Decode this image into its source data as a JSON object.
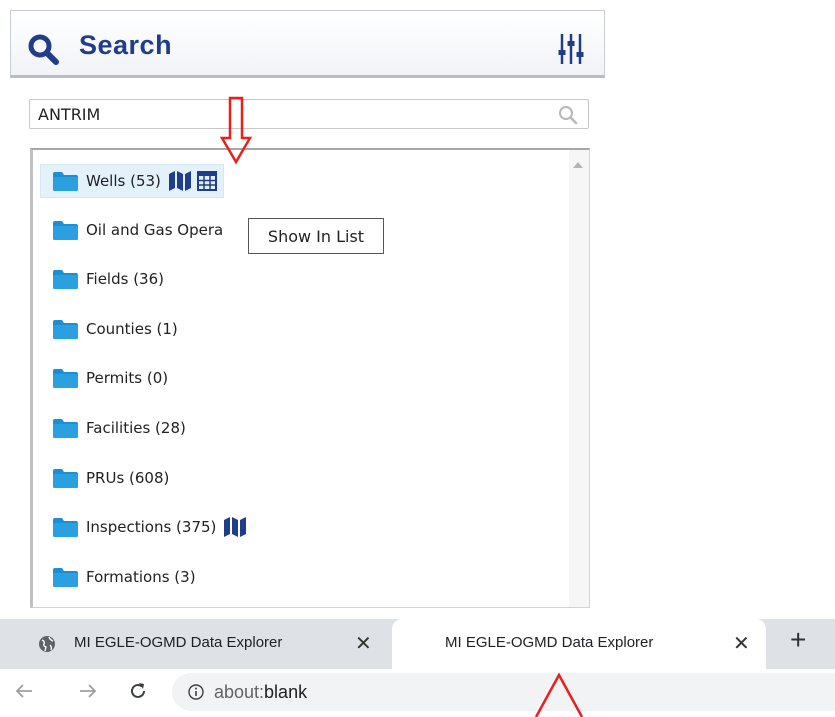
{
  "header": {
    "title": "Search",
    "icon": "search-icon",
    "settings_icon": "filter-sliders-icon"
  },
  "search": {
    "value": "ANTRIM"
  },
  "tree": {
    "items": [
      {
        "label": "Wells (53)",
        "has_map": true,
        "has_table": true,
        "selected": true
      },
      {
        "label": "Oil and Gas Opera",
        "has_map": false,
        "has_table": false
      },
      {
        "label": "Fields (36)",
        "has_map": false,
        "has_table": false
      },
      {
        "label": "Counties (1)",
        "has_map": false,
        "has_table": false
      },
      {
        "label": "Permits (0)",
        "has_map": false,
        "has_table": false
      },
      {
        "label": "Facilities (28)",
        "has_map": false,
        "has_table": false
      },
      {
        "label": "PRUs (608)",
        "has_map": false,
        "has_table": false
      },
      {
        "label": "Inspections (375)",
        "has_map": true,
        "has_table": false
      },
      {
        "label": "Formations (3)",
        "has_map": false,
        "has_table": false
      }
    ]
  },
  "tooltip": {
    "text": "Show In List"
  },
  "browser": {
    "tabs": [
      {
        "title": "MI EGLE-OGMD Data Explorer",
        "active": false
      },
      {
        "title": "MI EGLE-OGMD Data Explorer",
        "active": true
      }
    ],
    "close_glyph": "✕",
    "new_tab_glyph": "+",
    "url_prefix": "about:",
    "url_rest": "blank"
  },
  "colors": {
    "brand": "#1f3d8a",
    "folder": "#1b8fd1",
    "annotation": "#e8201e",
    "selected_bg": "#e3f1fa"
  }
}
